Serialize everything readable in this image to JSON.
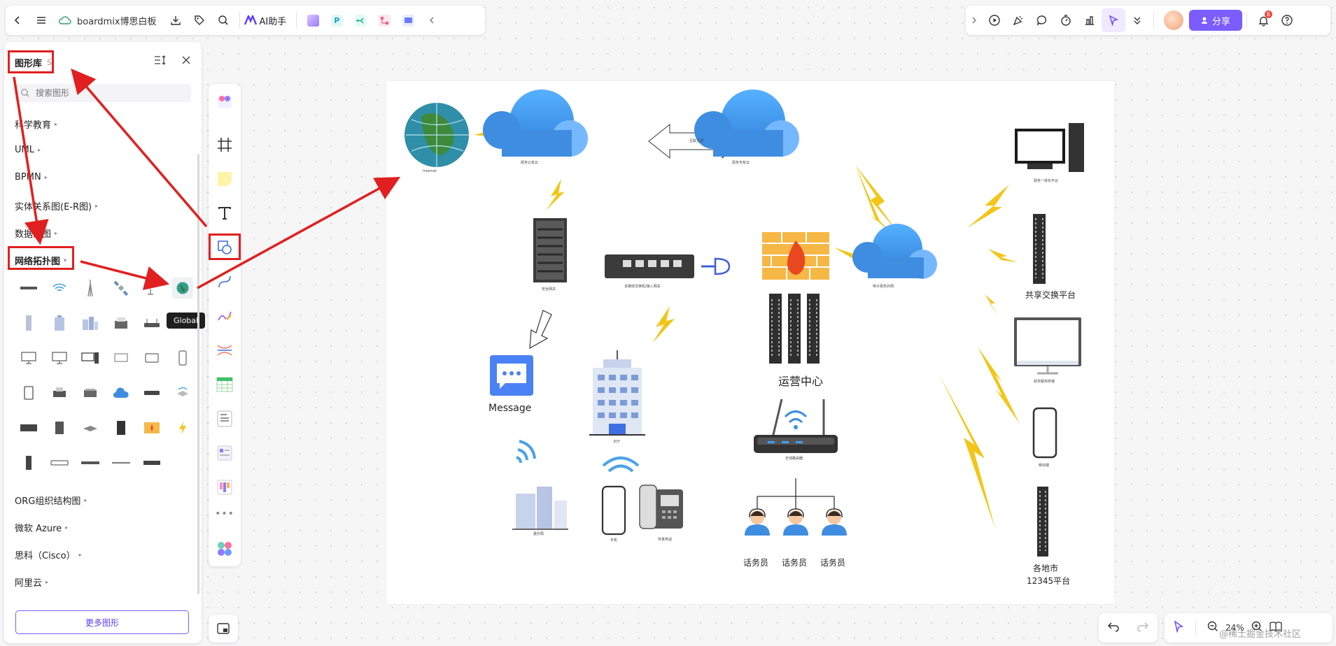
{
  "toolbar": {
    "app_name": "boardmix博思白板",
    "ai_label": "AI助手",
    "share_label": "分享",
    "notification_count": "6"
  },
  "library": {
    "title": "图形库",
    "shortcut": "S",
    "search_placeholder": "搜索图形",
    "categories_top": [
      "科学教育",
      "UML",
      "BPMN",
      "实体关系图(E-R图)",
      "数据流图",
      "网络拓扑图"
    ],
    "categories_bottom": [
      "ORG组织结构图",
      "微软 Azure",
      "思科（Cisco）",
      "阿里云"
    ],
    "tooltip": "Global",
    "more_button": "更多图形"
  },
  "canvas": {
    "labels": {
      "internet": "Internet",
      "cloud1": "政务公有云",
      "cloud2": "政务专有云",
      "arrow_text": "互联互通",
      "gateway": "安全网关",
      "switch": "多媒体交换机/接入网关",
      "message": "Message",
      "ops_center": "运营中心",
      "cloud3": "电子政务外网",
      "workstation": "政务一体化平台",
      "exchange": "共享交换平台",
      "monitor": "政务服务终端",
      "phone_right": "移动端",
      "city_platform_line1": "各地市",
      "city_platform_line2": "12345平台",
      "building": "大厅",
      "router": "无线路由器",
      "buildings2": "委办局",
      "mobile": "手机",
      "fax": "传真电话",
      "operator": "话务员"
    }
  },
  "zoom": {
    "level": "24%"
  },
  "watermark": "@稀土掘金技术社区"
}
